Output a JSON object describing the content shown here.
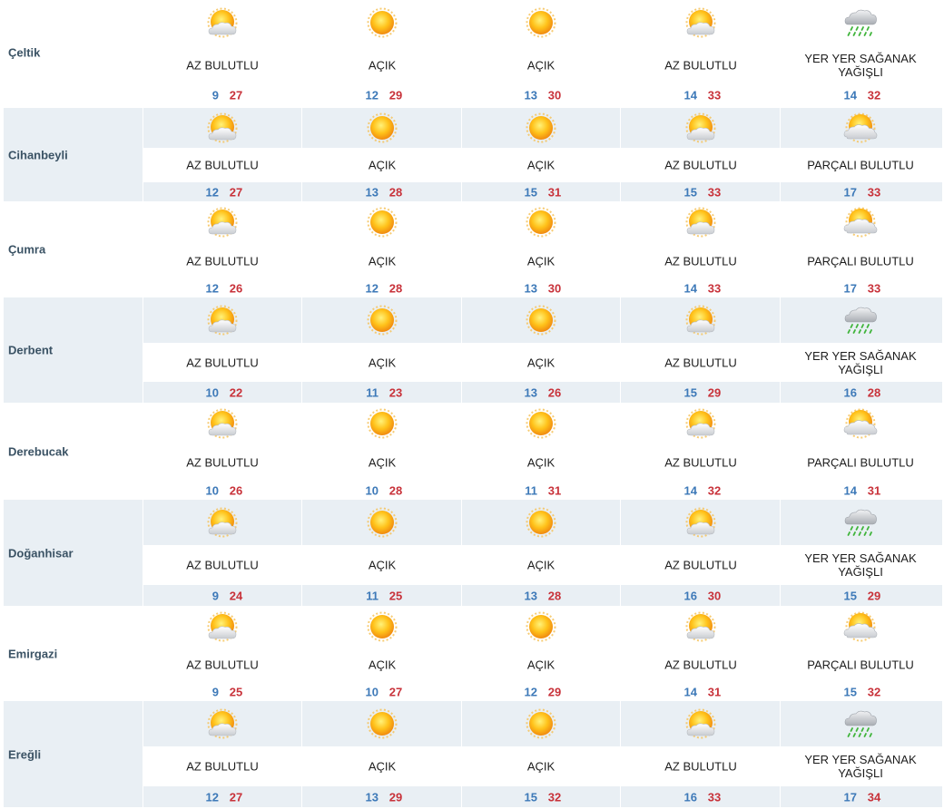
{
  "rows": [
    {
      "city": "Çeltik",
      "days": [
        {
          "icon": "partly-cloudy-icon",
          "cond": "AZ BULUTLU",
          "min": "9",
          "max": "27"
        },
        {
          "icon": "sun-icon",
          "cond": "AÇIK",
          "min": "12",
          "max": "29"
        },
        {
          "icon": "sun-icon",
          "cond": "AÇIK",
          "min": "13",
          "max": "30"
        },
        {
          "icon": "partly-cloudy-icon",
          "cond": "AZ BULUTLU",
          "min": "14",
          "max": "33"
        },
        {
          "icon": "rain-cloud-icon",
          "cond": "YER YER SAĞANAK YAĞIŞLI",
          "min": "14",
          "max": "32"
        }
      ]
    },
    {
      "city": "Cihanbeyli",
      "days": [
        {
          "icon": "partly-cloudy-icon",
          "cond": "AZ BULUTLU",
          "min": "12",
          "max": "27"
        },
        {
          "icon": "sun-icon",
          "cond": "AÇIK",
          "min": "13",
          "max": "28"
        },
        {
          "icon": "sun-icon",
          "cond": "AÇIK",
          "min": "15",
          "max": "31"
        },
        {
          "icon": "partly-cloudy-icon",
          "cond": "AZ BULUTLU",
          "min": "15",
          "max": "33"
        },
        {
          "icon": "mostly-cloudy-icon",
          "cond": "PARÇALI BULUTLU",
          "min": "17",
          "max": "33"
        }
      ]
    },
    {
      "city": "Çumra",
      "days": [
        {
          "icon": "partly-cloudy-icon",
          "cond": "AZ BULUTLU",
          "min": "12",
          "max": "26"
        },
        {
          "icon": "sun-icon",
          "cond": "AÇIK",
          "min": "12",
          "max": "28"
        },
        {
          "icon": "sun-icon",
          "cond": "AÇIK",
          "min": "13",
          "max": "30"
        },
        {
          "icon": "partly-cloudy-icon",
          "cond": "AZ BULUTLU",
          "min": "14",
          "max": "33"
        },
        {
          "icon": "mostly-cloudy-icon",
          "cond": "PARÇALI BULUTLU",
          "min": "17",
          "max": "33"
        }
      ]
    },
    {
      "city": "Derbent",
      "days": [
        {
          "icon": "partly-cloudy-icon",
          "cond": "AZ BULUTLU",
          "min": "10",
          "max": "22"
        },
        {
          "icon": "sun-icon",
          "cond": "AÇIK",
          "min": "11",
          "max": "23"
        },
        {
          "icon": "sun-icon",
          "cond": "AÇIK",
          "min": "13",
          "max": "26"
        },
        {
          "icon": "partly-cloudy-icon",
          "cond": "AZ BULUTLU",
          "min": "15",
          "max": "29"
        },
        {
          "icon": "rain-cloud-icon",
          "cond": "YER YER SAĞANAK YAĞIŞLI",
          "min": "16",
          "max": "28"
        }
      ]
    },
    {
      "city": "Derebucak",
      "days": [
        {
          "icon": "partly-cloudy-icon",
          "cond": "AZ BULUTLU",
          "min": "10",
          "max": "26"
        },
        {
          "icon": "sun-icon",
          "cond": "AÇIK",
          "min": "10",
          "max": "28"
        },
        {
          "icon": "sun-icon",
          "cond": "AÇIK",
          "min": "11",
          "max": "31"
        },
        {
          "icon": "partly-cloudy-icon",
          "cond": "AZ BULUTLU",
          "min": "14",
          "max": "32"
        },
        {
          "icon": "mostly-cloudy-icon",
          "cond": "PARÇALI BULUTLU",
          "min": "14",
          "max": "31"
        }
      ]
    },
    {
      "city": "Doğanhisar",
      "days": [
        {
          "icon": "partly-cloudy-icon",
          "cond": "AZ BULUTLU",
          "min": "9",
          "max": "24"
        },
        {
          "icon": "sun-icon",
          "cond": "AÇIK",
          "min": "11",
          "max": "25"
        },
        {
          "icon": "sun-icon",
          "cond": "AÇIK",
          "min": "13",
          "max": "28"
        },
        {
          "icon": "partly-cloudy-icon",
          "cond": "AZ BULUTLU",
          "min": "16",
          "max": "30"
        },
        {
          "icon": "rain-cloud-icon",
          "cond": "YER YER SAĞANAK YAĞIŞLI",
          "min": "15",
          "max": "29"
        }
      ]
    },
    {
      "city": "Emirgazi",
      "days": [
        {
          "icon": "partly-cloudy-icon",
          "cond": "AZ BULUTLU",
          "min": "9",
          "max": "25"
        },
        {
          "icon": "sun-icon",
          "cond": "AÇIK",
          "min": "10",
          "max": "27"
        },
        {
          "icon": "sun-icon",
          "cond": "AÇIK",
          "min": "12",
          "max": "29"
        },
        {
          "icon": "partly-cloudy-icon",
          "cond": "AZ BULUTLU",
          "min": "14",
          "max": "31"
        },
        {
          "icon": "mostly-cloudy-icon",
          "cond": "PARÇALI BULUTLU",
          "min": "15",
          "max": "32"
        }
      ]
    },
    {
      "city": "Ereğli",
      "days": [
        {
          "icon": "partly-cloudy-icon",
          "cond": "AZ BULUTLU",
          "min": "12",
          "max": "27"
        },
        {
          "icon": "sun-icon",
          "cond": "AÇIK",
          "min": "13",
          "max": "29"
        },
        {
          "icon": "sun-icon",
          "cond": "AÇIK",
          "min": "15",
          "max": "32"
        },
        {
          "icon": "partly-cloudy-icon",
          "cond": "AZ BULUTLU",
          "min": "16",
          "max": "33"
        },
        {
          "icon": "rain-cloud-icon",
          "cond": "YER YER SAĞANAK YAĞIŞLI",
          "min": "17",
          "max": "34"
        }
      ]
    }
  ],
  "colors": {
    "min": "#3d79b8",
    "max": "#c8323a",
    "band": "#e9eff4",
    "city": "#3a5264"
  }
}
